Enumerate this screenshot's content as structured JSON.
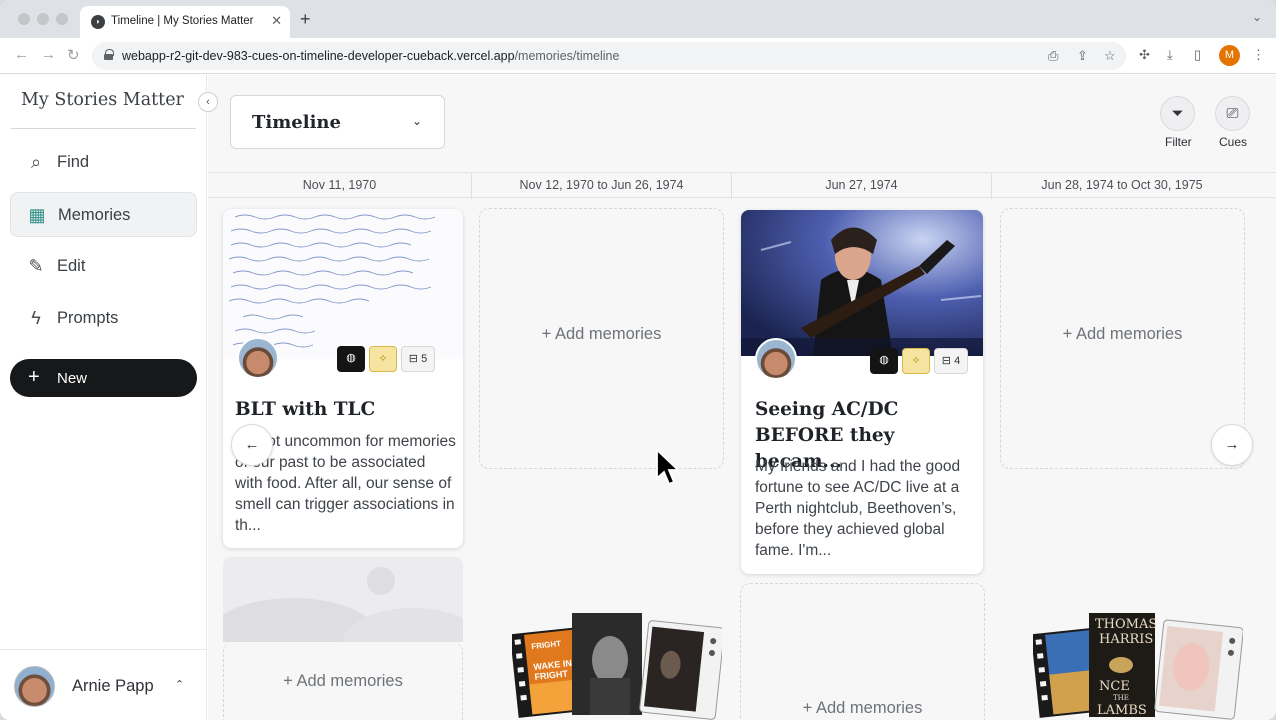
{
  "browser": {
    "tab_title": "Timeline | My Stories Matter",
    "tab_close": "✕",
    "new_tab": "+",
    "tab_menu": "⌄",
    "url_host": "webapp-r2-git-dev-983-cues-on-timeline-developer-cueback.vercel.app",
    "url_path": "/memories/timeline",
    "profile_initial": "M",
    "profile_color": "#e37400"
  },
  "sidebar": {
    "brand": "My Stories Matter",
    "collapse_glyph": "‹",
    "items": [
      {
        "label": "Find",
        "icon": "search-icon",
        "glyph": "⌕"
      },
      {
        "label": "Memories",
        "icon": "calendar-icon",
        "glyph": "▦"
      },
      {
        "label": "Edit",
        "icon": "pencil-icon",
        "glyph": "✎"
      },
      {
        "label": "Prompts",
        "icon": "lightning-icon",
        "glyph": "ϟ"
      }
    ],
    "new_label": "New",
    "new_glyph": "+",
    "user_name": "Arnie Papp",
    "user_caret": "⌃"
  },
  "main": {
    "timeline_label": "Timeline",
    "timeline_caret": "⌄",
    "filter_label": "Filter",
    "cues_label": "Cues",
    "filter_glyph": "⏷",
    "cues_glyph": "⎚",
    "dates": [
      "Nov 11, 1970",
      "Nov 12, 1970 to Jun 26, 1974",
      "Jun 27, 1974",
      "Jun 28, 1974 to Oct 30, 1975"
    ],
    "add_memories": "+ Add memories",
    "prev_glyph": "←",
    "next_glyph": "→"
  },
  "cards": [
    {
      "title": "BLT with TLC",
      "body": "It's not uncommon for memories of our past to be associated with food. After all, our sense of smell can trigger associations in th...",
      "count": "5",
      "badge_dark": "◍",
      "badge_gold": "✧",
      "badge_count_icon": "⊟"
    },
    {
      "title": "Seeing AC/DC BEFORE they becam...",
      "body": "My friends and I had the good fortune to see AC/DC live at a Perth nightclub, Beethoven’s, before they achieved global fame. I'm...",
      "count": "4",
      "badge_dark": "◍",
      "badge_gold": "✧",
      "badge_count_icon": "⊟"
    }
  ],
  "cue_reels": [
    {
      "poster_text": [
        "FRIGHT",
        "WAKE IN",
        "FRIGHT"
      ]
    },
    {
      "poster_text": [
        "THOMAS",
        "HARRIS",
        "NCE",
        "THE",
        "LAMBS"
      ]
    }
  ],
  "colors": {
    "accent_dark": "#17181a",
    "gold_badge": "#f6e5a0",
    "sidebar_active": "#f1f2f4"
  }
}
